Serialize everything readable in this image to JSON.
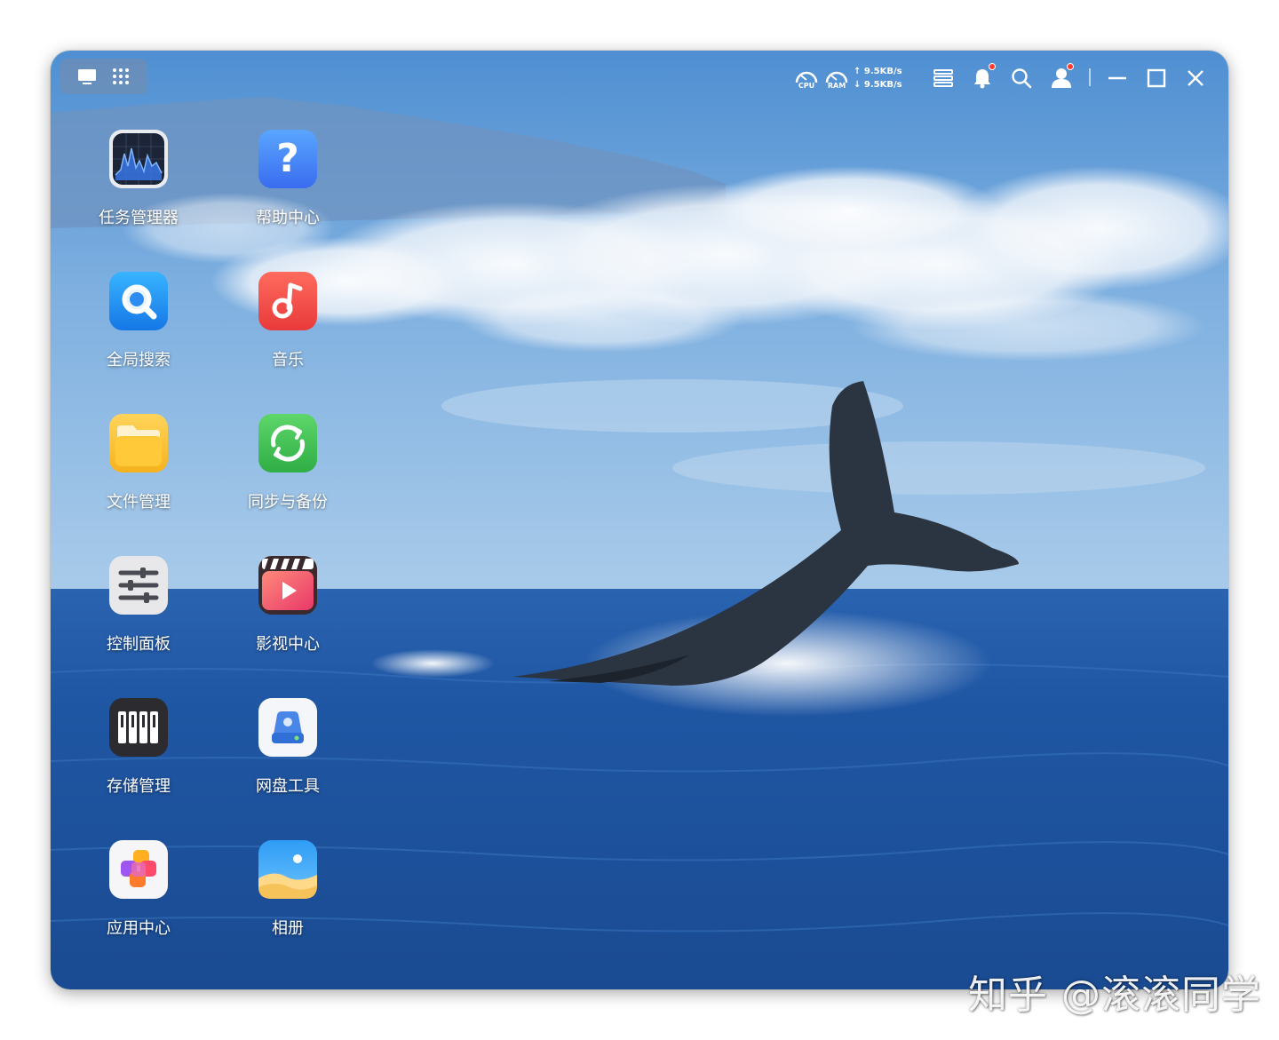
{
  "topbar": {
    "cpu_label": "CPU",
    "ram_label": "RAM",
    "upload": "↑ 9.5KB/s",
    "download": "↓ 9.5KB/s"
  },
  "apps": [
    {
      "label": "任务管理器",
      "icon": "task-manager-icon"
    },
    {
      "label": "帮助中心",
      "icon": "help-icon"
    },
    {
      "label": "全局搜索",
      "icon": "search-app-icon"
    },
    {
      "label": "音乐",
      "icon": "music-icon"
    },
    {
      "label": "文件管理",
      "icon": "folder-icon"
    },
    {
      "label": "同步与备份",
      "icon": "sync-icon"
    },
    {
      "label": "控制面板",
      "icon": "control-panel-icon"
    },
    {
      "label": "影视中心",
      "icon": "video-icon"
    },
    {
      "label": "存储管理",
      "icon": "storage-icon"
    },
    {
      "label": "网盘工具",
      "icon": "cloud-drive-icon"
    },
    {
      "label": "应用中心",
      "icon": "app-center-icon"
    },
    {
      "label": "相册",
      "icon": "photos-icon"
    }
  ],
  "watermark": "知乎 @滚滚同学",
  "colors": {
    "notification_dot": "#ff3b30",
    "sky": "#5e9ad6",
    "sea": "#1d4f9a"
  }
}
